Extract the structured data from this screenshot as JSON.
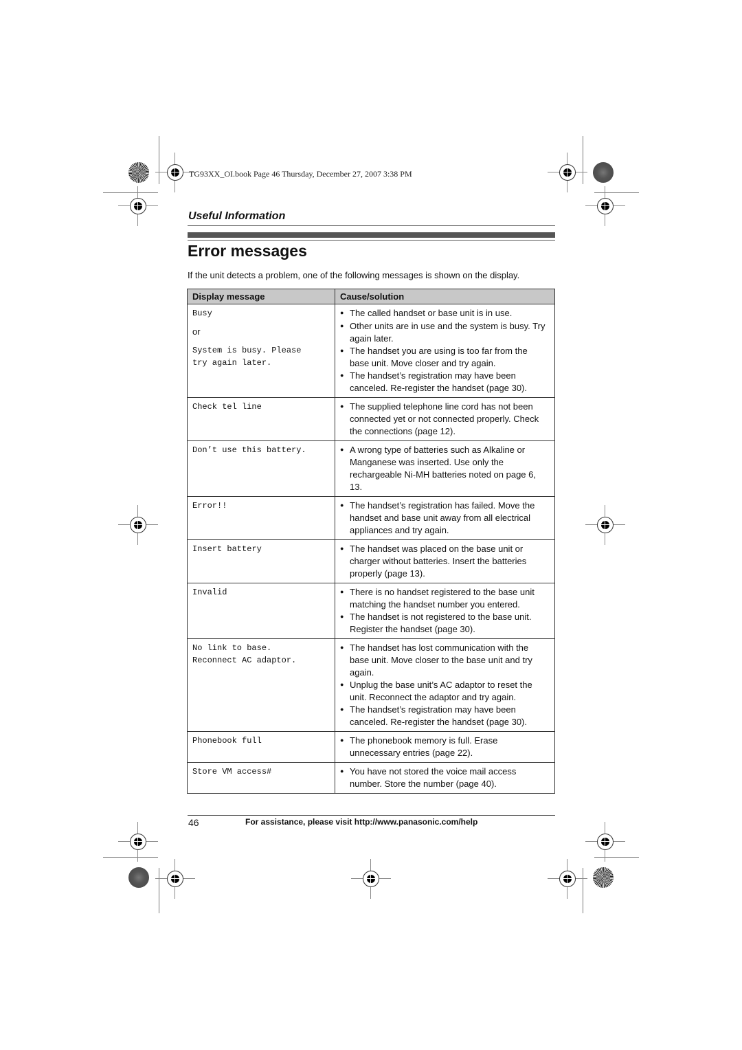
{
  "print_header": "TG93XX_OI.book  Page 46  Thursday, December 27, 2007  3:38 PM",
  "section": "Useful Information",
  "title": "Error messages",
  "intro": "If the unit detects a problem, one of the following messages is shown on the display.",
  "table": {
    "headers": [
      "Display message",
      "Cause/solution"
    ],
    "rows": [
      {
        "messages": [
          "Busy",
          "or",
          "System is busy. Please",
          "try again later."
        ],
        "causes": [
          "The called handset or base unit is in use.",
          "Other units are in use and the system is busy. Try again later.",
          "The handset you are using is too far from the base unit. Move closer and try again.",
          "The handset’s registration may have been canceled. Re-register the handset (page 30)."
        ]
      },
      {
        "messages": [
          "Check tel line"
        ],
        "causes": [
          "The supplied telephone line cord has not been connected yet or not connected properly. Check the connections (page 12)."
        ]
      },
      {
        "messages": [
          "Don’t use this battery."
        ],
        "causes": [
          "A wrong type of batteries such as Alkaline or Manganese was inserted. Use only the rechargeable Ni-MH batteries noted on page 6, 13."
        ]
      },
      {
        "messages": [
          "Error!!"
        ],
        "causes": [
          "The handset’s registration has failed. Move the handset and base unit away from all electrical appliances and try again."
        ]
      },
      {
        "messages": [
          "Insert battery"
        ],
        "causes": [
          "The handset was placed on the base unit or charger without batteries. Insert the batteries properly (page 13)."
        ]
      },
      {
        "messages": [
          "Invalid"
        ],
        "causes": [
          "There is no handset registered to the base unit matching the handset number you entered.",
          "The handset is not registered to the base unit. Register the handset (page 30)."
        ]
      },
      {
        "messages": [
          "No link to base.",
          "Reconnect AC adaptor."
        ],
        "causes": [
          "The handset has lost communication with the base unit. Move closer to the base unit and try again.",
          "Unplug the base unit’s AC adaptor to reset the unit. Reconnect the adaptor and try again.",
          "The handset’s registration may have been canceled. Re-register the handset (page 30)."
        ]
      },
      {
        "messages": [
          "Phonebook full"
        ],
        "causes": [
          "The phonebook memory is full. Erase unnecessary entries (page 22)."
        ]
      },
      {
        "messages": [
          "Store VM access#"
        ],
        "causes": [
          "You have not stored the voice mail access number. Store the number (page 40)."
        ]
      }
    ]
  },
  "footer": {
    "page_number": "46",
    "text": "For assistance, please visit http://www.panasonic.com/help"
  }
}
